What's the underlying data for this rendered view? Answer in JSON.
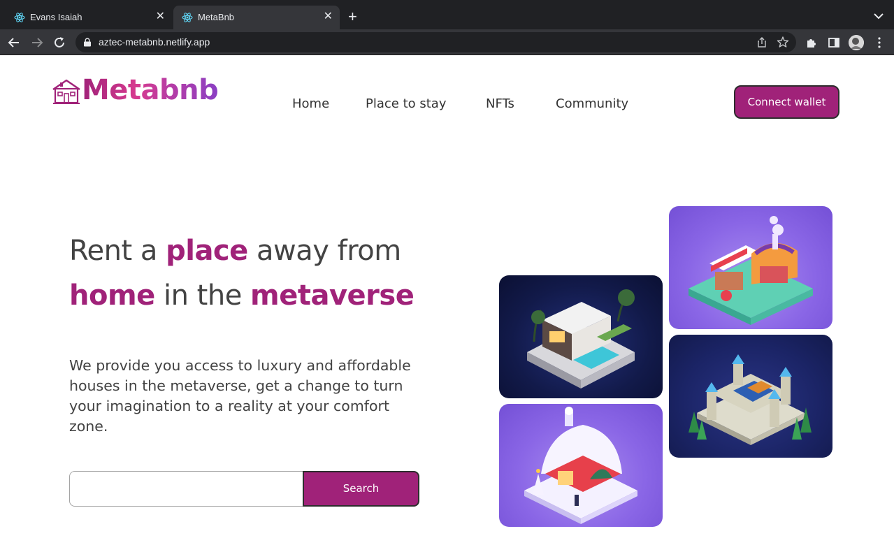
{
  "browser": {
    "tabs": [
      {
        "title": "Evans Isaiah",
        "favicon": "react-icon",
        "active": false
      },
      {
        "title": "MetaBnb",
        "favicon": "react-icon",
        "active": true
      }
    ],
    "url": "aztec-metabnb.netlify.app"
  },
  "header": {
    "logo_text": "Metabnb",
    "nav": [
      "Home",
      "Place to stay",
      "NFTs",
      "Community"
    ],
    "connect_label": "Connect wallet"
  },
  "hero": {
    "headline_parts": [
      "Rent a ",
      "place",
      " away from",
      "home",
      " in the ",
      "metaverse"
    ],
    "description": "We provide you access to luxury and affordable houses in the metaverse, get a change to turn your imagination to a reality at your comfort zone.",
    "search_placeholder": "",
    "search_label": "Search"
  },
  "colors": {
    "accent": "#a02279",
    "text": "#434343",
    "chrome_dark": "#202124",
    "chrome_mid": "#35363a"
  },
  "gallery": [
    {
      "name": "modern-villa-image"
    },
    {
      "name": "market-stall-image"
    },
    {
      "name": "snow-cottage-image"
    },
    {
      "name": "castle-image"
    }
  ]
}
